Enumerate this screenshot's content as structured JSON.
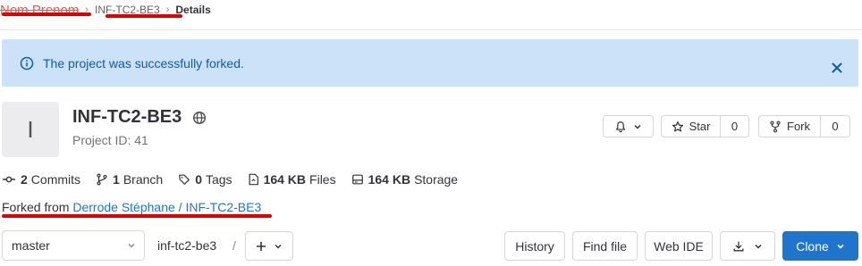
{
  "breadcrumb": {
    "user": "Nom Prenom",
    "project": "INF-TC2-BE3",
    "current": "Details",
    "separator": "›"
  },
  "alert": {
    "message": "The project was successfully forked.",
    "close_label": "×"
  },
  "project": {
    "avatar_letter": "I",
    "name": "INF-TC2-BE3",
    "id_text": "Project ID: 41",
    "visibility_icon": "globe-icon"
  },
  "actions": {
    "star_label": "Star",
    "star_count": "0",
    "fork_label": "Fork",
    "fork_count": "0"
  },
  "stats": {
    "commits_count": "2",
    "commits_label": "Commits",
    "branch_count": "1",
    "branch_label": "Branch",
    "tags_count": "0",
    "tags_label": "Tags",
    "files_size": "164 KB",
    "files_label": "Files",
    "storage_size": "164 KB",
    "storage_label": "Storage"
  },
  "fork_info": {
    "prefix": "Forked from",
    "source": "Derrode Stéphane / INF-TC2-BE3"
  },
  "toolbar": {
    "branch": "master",
    "path_root": "inf-tc2-be3",
    "path_sep": "/",
    "history_label": "History",
    "find_file_label": "Find file",
    "web_ide_label": "Web IDE",
    "clone_label": "Clone"
  },
  "colors": {
    "accent": "#1f75cb",
    "alert_bg": "#cbe2f9",
    "annotation_red": "#e00000"
  }
}
